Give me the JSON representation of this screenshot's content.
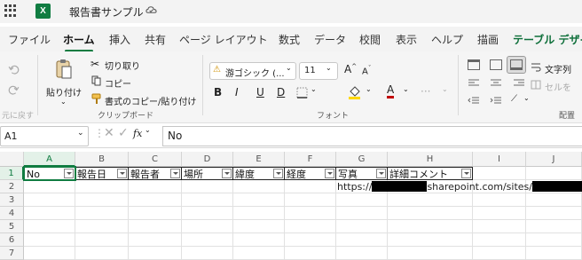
{
  "app": {
    "logo": "X",
    "title": "報告書サンプル"
  },
  "tabs": [
    "ファイル",
    "ホーム",
    "挿入",
    "共有",
    "ページ レイアウト",
    "数式",
    "データ",
    "校閲",
    "表示",
    "ヘルプ",
    "描画",
    "テーブル デザイン"
  ],
  "ribbon": {
    "undo_group_label": "元に戻す",
    "clipboard": {
      "paste_label": "貼り付け",
      "cut_label": "切り取り",
      "copy_label": "コピー",
      "format_painter_label": "書式のコピー/貼り付け",
      "group_label": "クリップボード"
    },
    "font": {
      "font_name": "游ゴシック (...",
      "font_size": "11",
      "bold": "B",
      "italic": "I",
      "underline": "U",
      "strike": "D",
      "group_label": "フォント",
      "font_color": "#c00000",
      "fill_color": "#ffd800"
    },
    "alignment": {
      "wrap_label": "文字列",
      "merge_label": "セルを",
      "group_label": "配置"
    }
  },
  "formula_bar": {
    "cell_ref": "A1",
    "fx": "fx",
    "value": "No"
  },
  "grid": {
    "columns": [
      "A",
      "B",
      "C",
      "D",
      "E",
      "F",
      "G",
      "H",
      "I",
      "J"
    ],
    "rows": [
      "1",
      "2",
      "3",
      "4",
      "5",
      "6",
      "7"
    ],
    "header_row": [
      "No",
      "報告日",
      "報告者",
      "場所",
      "緯度",
      "経度",
      "写真",
      "詳細コメント"
    ],
    "row2_g_prefix": "https://",
    "row2_g_middle": "sharepoint.com/sites/"
  }
}
